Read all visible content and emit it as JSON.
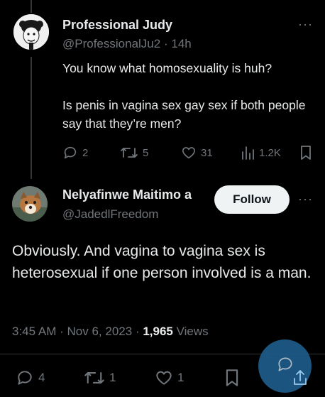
{
  "parent_tweet": {
    "author_name": "Professional Judy",
    "handle": "@ProfessionalJu2",
    "separator": "·",
    "time": "14h",
    "text_line1": "You know what homosexuality is huh?",
    "text_line2": "Is penis in vagina sex gay sex if both people say that they’re men?",
    "replies": "2",
    "retweets": "5",
    "likes": "31",
    "views": "1.2K",
    "more": "···"
  },
  "main_tweet": {
    "author_name": "Nelyafinwe Maitimo a",
    "handle": "@JadedlFreedom",
    "follow_label": "Follow",
    "more": "···",
    "text": "Obviously. And vagina to vagina sex is heterosexual if one person involved is a man.",
    "time": "3:45 AM",
    "dot": "·",
    "date": "Nov 6, 2023",
    "dot2": "·",
    "views_count": "1,965",
    "views_label": "Views",
    "replies": "4",
    "retweets": "1",
    "likes": "1"
  },
  "colors": {
    "background": "#000000",
    "text": "#e7e9ea",
    "muted": "#71767b",
    "fab": "#1d9bf0"
  },
  "icons": [
    "reply-icon",
    "retweet-icon",
    "like-icon",
    "views-icon",
    "bookmark-icon",
    "share-icon",
    "compose-icon"
  ]
}
